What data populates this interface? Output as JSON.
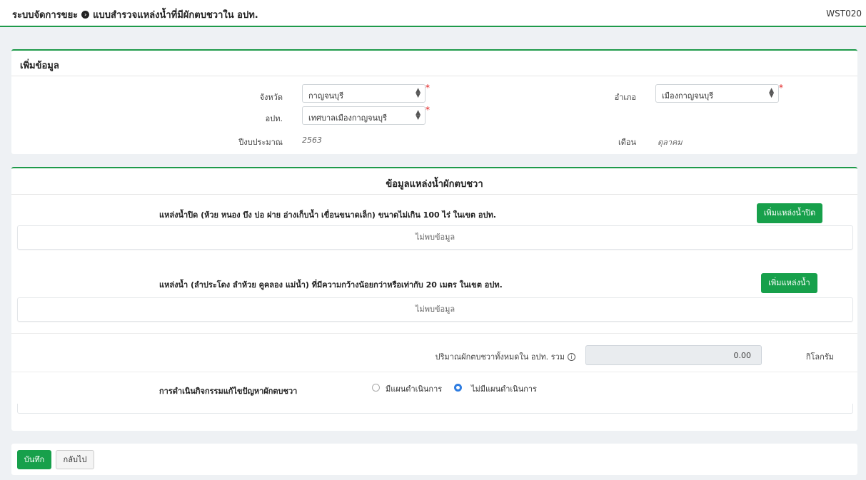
{
  "header": {
    "system": "ระบบจัดการขยะ",
    "separator_icon": "chevron-circle-icon",
    "form_title": "แบบสำรวจแหล่งน้ำที่มีผักตบชวาใน อปท.",
    "code": "WST020"
  },
  "add_info": {
    "title": "เพิ่มข้อมูล",
    "province_label": "จังหวัด",
    "province_value": "กาญจนบุรี",
    "district_label": "อำเภอ",
    "district_value": "เมืองกาญจนบุรี",
    "lao_label": "อปท.",
    "lao_value": "เทศบาลเมืองกาญจนบุรี",
    "year_label": "ปีงบประมาณ",
    "year_value": "2563",
    "month_label": "เดือน",
    "month_value": "ตุลาคม",
    "required_mark": "*"
  },
  "water": {
    "title": "ข้อมูลแหล่งน้ำผักตบชวา",
    "closed_title": "แหล่งน้ำปิด (ห้วย หนอง บึง บ่อ ฝาย อ่างเก็บน้ำ เขื่อนขนาดเล็ก) ขนาดไม่เกิน 100 ไร่ ในเขต อปท.",
    "closed_button": "เพิ่มแหล่งน้ำปิด",
    "closed_empty": "ไม่พบข้อมูล",
    "open_title": "แหล่งน้ำ (ลำประโดง ลำห้วย คูคลอง แม่น้ำ) ที่มีความกว้างน้อยกว่าหรือเท่ากับ 20 เมตร ในเขต อปท.",
    "open_button": "เพิ่มแหล่งน้ำ",
    "open_empty": "ไม่พบข้อมูล",
    "total_label": "ปริมาณผักตบชวาทั้งหมดใน อปท. รวม",
    "total_value": "0.00",
    "total_unit": "กิโลกรัม",
    "info_icon": "info-circle-icon",
    "activity_label": "การดำเนินกิจกรรมแก้ไขปัญหาผักตบชวา",
    "option_plan": "มีแผนดำเนินการ",
    "option_no_plan": "ไม่มีแผนดำเนินการ",
    "selected_option": "ไม่มีแผนดำเนินการ"
  },
  "footer": {
    "save_label": "บันทึก",
    "back_label": "กลับไป"
  },
  "colors": {
    "primary_green": "#17a04b",
    "radio_blue": "#2f7de1",
    "required_red": "#e02020"
  }
}
